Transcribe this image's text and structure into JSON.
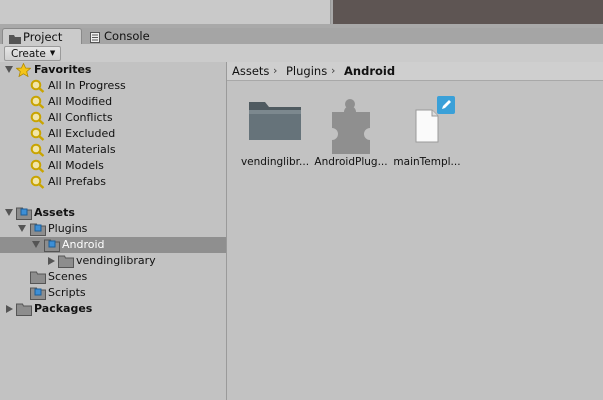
{
  "tabs": [
    {
      "label": "Project",
      "icon": "folder-icon",
      "active": true
    },
    {
      "label": "Console",
      "icon": "console-icon",
      "active": false
    }
  ],
  "toolbar": {
    "create_label": "Create"
  },
  "tree": {
    "favorites": {
      "label": "Favorites",
      "items": [
        "All In Progress",
        "All Modified",
        "All Conflicts",
        "All Excluded",
        "All Materials",
        "All Models",
        "All Prefabs"
      ]
    },
    "assets_label": "Assets",
    "plugins_label": "Plugins",
    "android_label": "Android",
    "vendinglibrary_label": "vendinglibrary",
    "scenes_label": "Scenes",
    "scripts_label": "Scripts",
    "packages_label": "Packages"
  },
  "breadcrumb": [
    "Assets",
    "Plugins",
    "Android"
  ],
  "assets": [
    {
      "name": "vendinglibr...",
      "kind": "folder"
    },
    {
      "name": "AndroidPlug...",
      "kind": "plugin"
    },
    {
      "name": "mainTempl...",
      "kind": "file"
    }
  ],
  "colors": {
    "selection": "#8f8f8f",
    "star": "#f5c518",
    "edit_badge": "#3aa0d8"
  }
}
